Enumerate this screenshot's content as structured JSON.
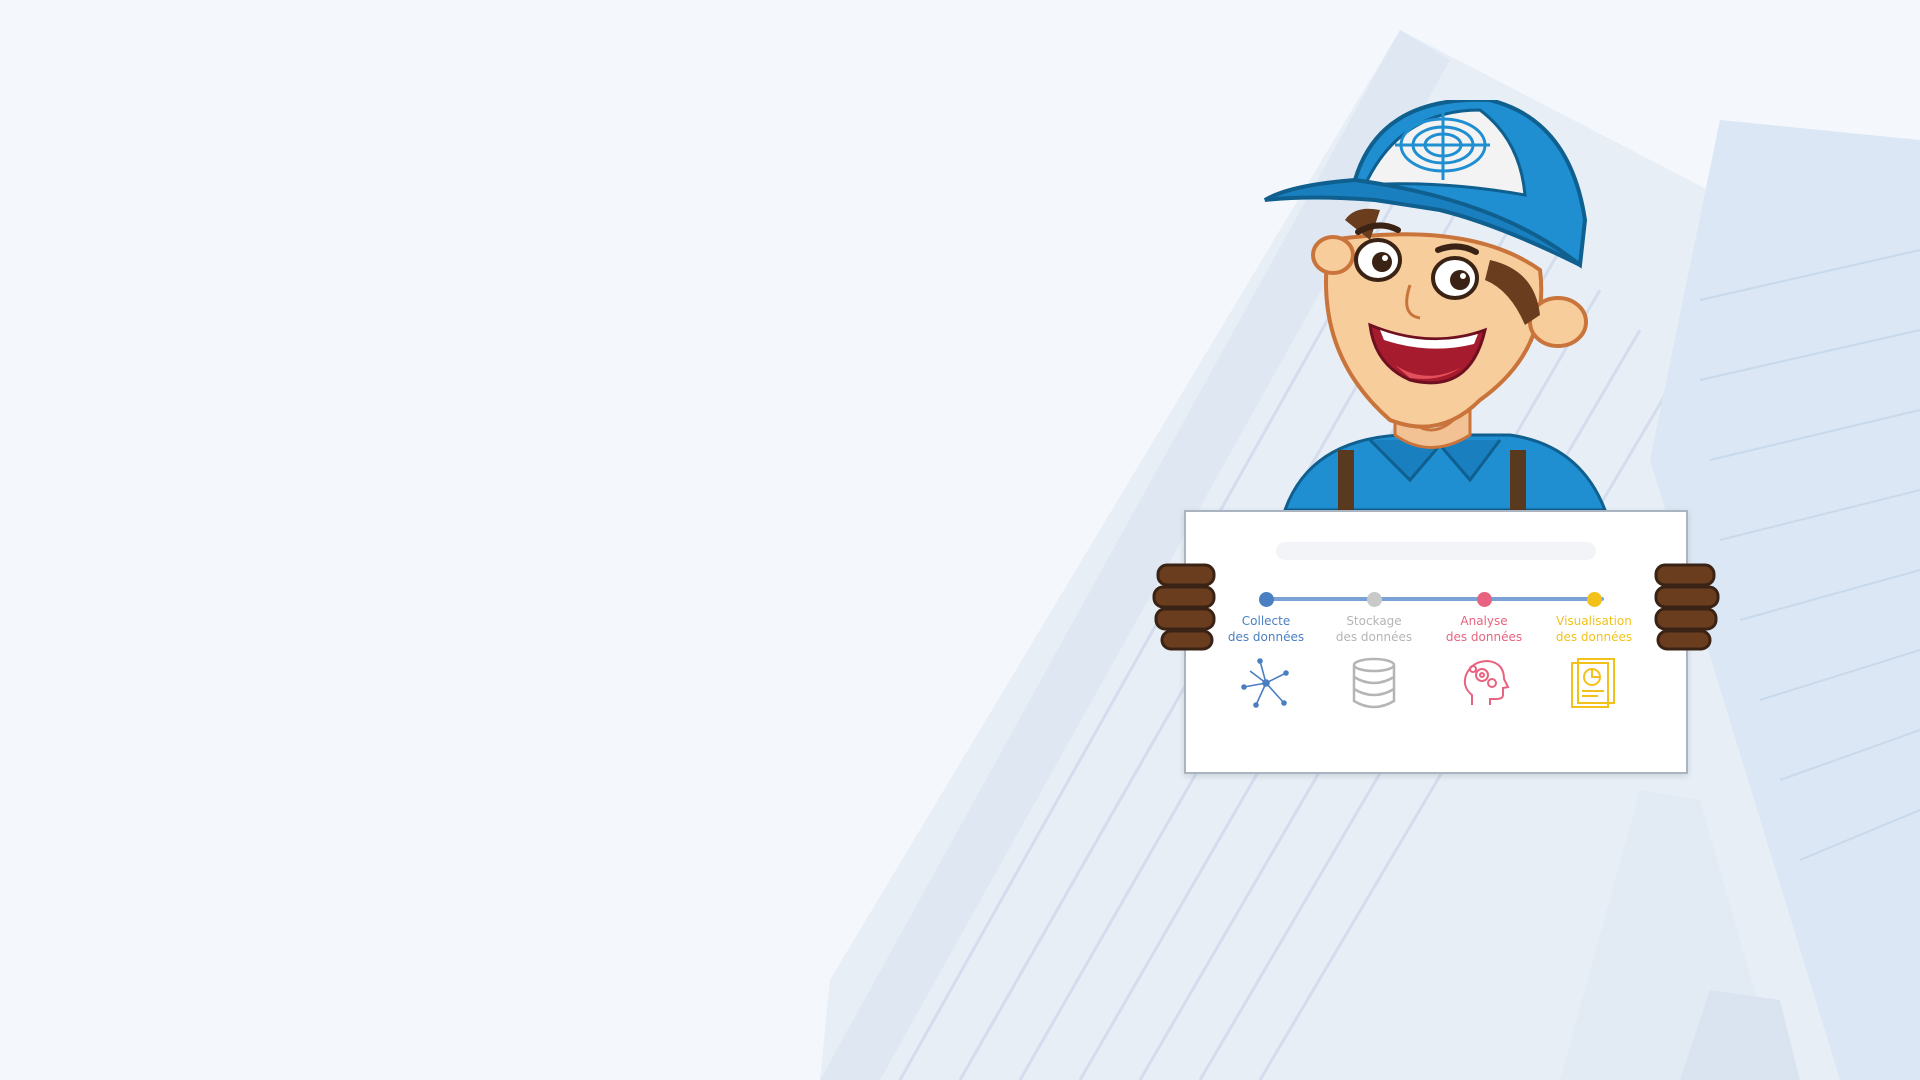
{
  "colors": {
    "background": "#f4f7fc",
    "collecte": "#4a7fc1",
    "stockage": "#b5b5b5",
    "analyse": "#e8637f",
    "visualisation": "#f2c21a",
    "cap_blue": "#1f8fd1"
  },
  "board": {
    "steps": [
      {
        "line1": "Collecte",
        "line2": "des données",
        "icon": "network-icon"
      },
      {
        "line1": "Stockage",
        "line2": "des données",
        "icon": "database-icon"
      },
      {
        "line1": "Analyse",
        "line2": "des données",
        "icon": "brain-gear-icon"
      },
      {
        "line1": "Visualisation",
        "line2": "des données",
        "icon": "report-chart-icon"
      }
    ]
  }
}
